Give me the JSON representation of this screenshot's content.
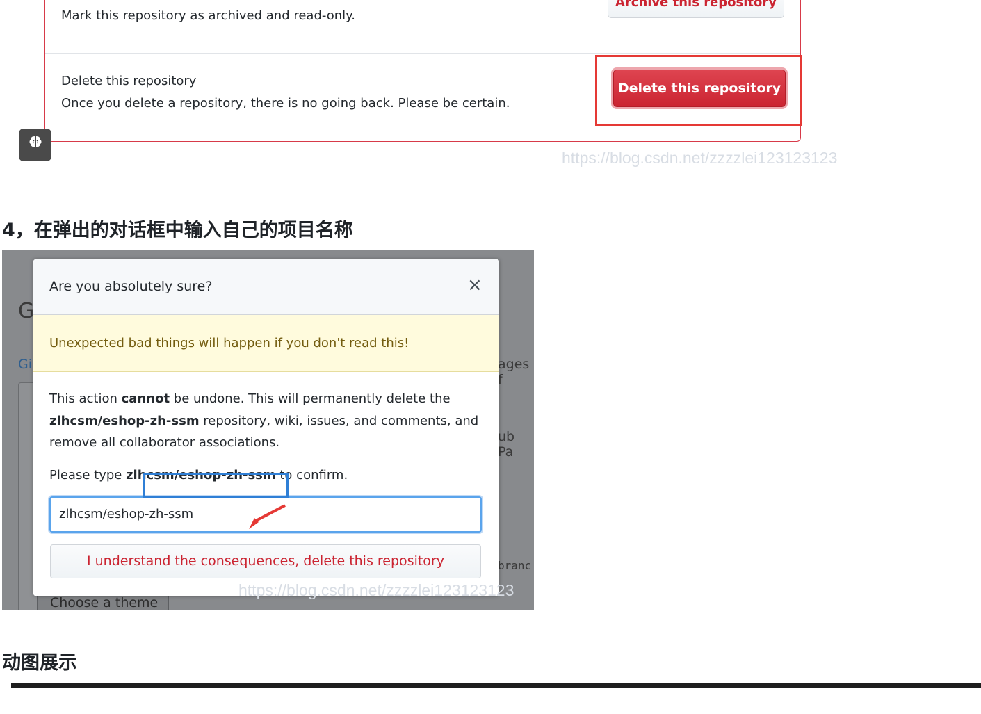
{
  "archive_section": {
    "description": "Mark this repository as archived and read-only.",
    "button_label": "Archive this repository"
  },
  "delete_section": {
    "title": "Delete this repository",
    "description": "Once you delete a repository, there is no going back. Please be certain.",
    "button_label": "Delete this repository"
  },
  "watermark_1": "https://blog.csdn.net/zzzzlei123123123",
  "step_heading": "4，在弹出的对话框中输入自己的项目名称",
  "background_fragments": {
    "g": "G",
    "gi": "Gi",
    "ages": "ages f",
    "ub_pa": "ub Pa",
    "branc": "branc",
    "theme_button": "Choose a theme"
  },
  "modal": {
    "title": "Are you absolutely sure?",
    "close_glyph": "×",
    "warning": "Unexpected bad things will happen if you don't read this!",
    "line1_a": "This action ",
    "line1_b": "cannot",
    "line1_c": " be undone. This will permanently delete the",
    "line2_a": "zlhcsm/eshop-zh-ssm",
    "line2_b": " repository, wiki, issues, and comments, and",
    "line3": "remove all collaborator associations.",
    "confirm_a": "Please type ",
    "confirm_b": "zlhcsm/eshop-zh-ssm",
    "confirm_c": " to confirm.",
    "input_value": "zlhcsm/eshop-zh-ssm",
    "button_label": "I understand the consequences, delete this repository"
  },
  "watermark_2": "https://blog.csdn.net/zzzzlei123123123",
  "section_heading": "动图展示",
  "colors": {
    "danger": "#cb2431",
    "highlight_red": "#e53935",
    "highlight_blue": "#2f7fd6",
    "flash_bg": "#fffbdd"
  }
}
